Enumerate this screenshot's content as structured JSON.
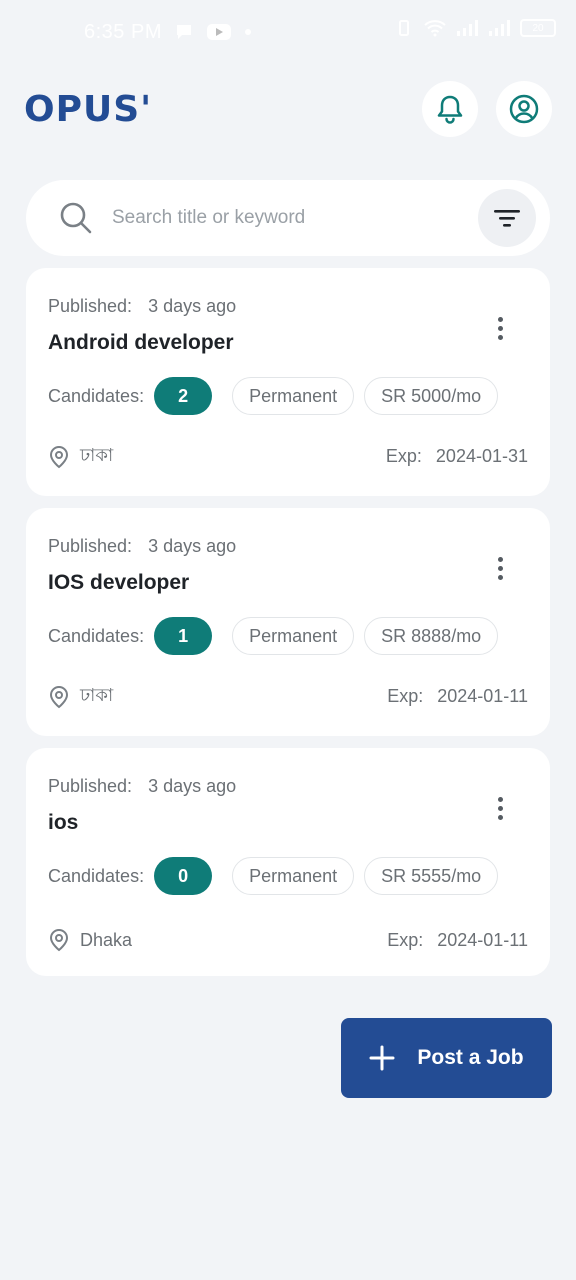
{
  "status_bar": {
    "time": "6:35 PM",
    "battery": "20"
  },
  "header": {
    "logo": "OPUS'",
    "notification_icon": "bell-icon",
    "profile_icon": "user-circle-icon"
  },
  "search": {
    "placeholder": "Search title or keyword",
    "value": ""
  },
  "jobs": [
    {
      "published_label": "Published:",
      "published_value": "3 days ago",
      "title": "Android developer",
      "candidates_label": "Candidates:",
      "candidates_count": "2",
      "type": "Permanent",
      "salary": "SR  5000/mo",
      "location": "ঢাকা",
      "exp_label": "Exp:",
      "exp_date": "2024-01-31"
    },
    {
      "published_label": "Published:",
      "published_value": "3 days ago",
      "title": "IOS developer",
      "candidates_label": "Candidates:",
      "candidates_count": "1",
      "type": "Permanent",
      "salary": "SR  8888/mo",
      "location": "ঢাকা",
      "exp_label": "Exp:",
      "exp_date": "2024-01-11"
    },
    {
      "published_label": "Published:",
      "published_value": "3 days ago",
      "title": "ios",
      "candidates_label": "Candidates:",
      "candidates_count": "0",
      "type": "Permanent",
      "salary": "SR  5555/mo",
      "location": "Dhaka",
      "exp_label": "Exp:",
      "exp_date": "2024-01-11"
    }
  ],
  "post_job": {
    "label": "Post a Job"
  },
  "colors": {
    "brand": "#234c94",
    "badge": "#0f7c78",
    "background": "#f2f4f7"
  }
}
